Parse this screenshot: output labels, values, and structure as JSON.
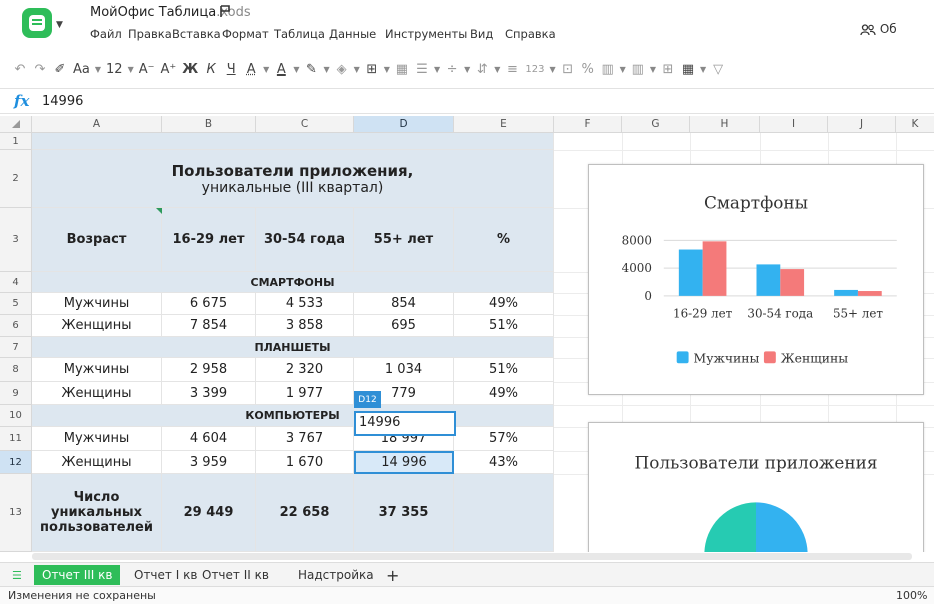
{
  "app": {
    "title": "МойОфис Таблица",
    "ext": ".xods",
    "menu": [
      "Файл",
      "Правка",
      "Вставка",
      "Формат",
      "Таблица",
      "Данные",
      "Инструменты",
      "Вид",
      "Справка"
    ],
    "share": "Об"
  },
  "toolbar": {
    "font_btn": "Aa",
    "font_size": "12",
    "decrease_font": "A⁻",
    "increase_font": "A⁺",
    "bold": "Ж",
    "italic": "К",
    "underline": "Ч",
    "strike": "A",
    "number_format": "123",
    "percent": "%"
  },
  "formula": {
    "icon": "fx",
    "value": "14996"
  },
  "columns": [
    "A",
    "B",
    "C",
    "D",
    "E",
    "F",
    "G",
    "H",
    "I",
    "J",
    "K"
  ],
  "rows": [
    "1",
    "2",
    "3",
    "4",
    "5",
    "6",
    "7",
    "8",
    "9",
    "10",
    "11",
    "12",
    "13"
  ],
  "sheet": {
    "title1": "Пользователи приложения,",
    "title2": "уникальные (III квартал)",
    "head": [
      "Возраст",
      "16-29 лет",
      "30-54 года",
      "55+ лет",
      "%"
    ],
    "sec_phones": "СМАРТФОНЫ",
    "sec_tablets": "ПЛАНШЕТЫ",
    "sec_pc": "КОМПЬЮТЕРЫ",
    "r5": [
      "Мужчины",
      "6 675",
      "4 533",
      "854",
      "49%"
    ],
    "r6": [
      "Женщины",
      "7 854",
      "3 858",
      "695",
      "51%"
    ],
    "r8": [
      "Мужчины",
      "2 958",
      "2 320",
      "1 034",
      "51%"
    ],
    "r9": [
      "Женщины",
      "3 399",
      "1 977",
      "779",
      "49%"
    ],
    "r11": [
      "Мужчины",
      "4 604",
      "3 767",
      "18 997",
      "57%"
    ],
    "r12": [
      "Женщины",
      "3 959",
      "1 670",
      "14 996",
      "43%"
    ],
    "r13_label": "Число уникальных пользователей",
    "r13": [
      "29 449",
      "22 658",
      "37 355"
    ]
  },
  "edit": {
    "ref": "D12",
    "value": "14996"
  },
  "chart_data": [
    {
      "type": "bar",
      "title": "Смартфоны",
      "categories": [
        "16-29 лет",
        "30-54 года",
        "55+ лет"
      ],
      "series": [
        {
          "name": "Мужчины",
          "values": [
            6675,
            4533,
            854
          ],
          "color": "#33b2f0"
        },
        {
          "name": "Женщины",
          "values": [
            7854,
            3858,
            695
          ],
          "color": "#f47a7a"
        }
      ],
      "yticks": [
        "8000",
        "4000",
        "0"
      ],
      "ylim": [
        0,
        8000
      ],
      "legend": "bottom"
    },
    {
      "type": "pie",
      "title": "Пользователи приложения",
      "colors": [
        "#26cbb2",
        "#33b2f0"
      ]
    }
  ],
  "tabs": [
    "Отчет III кв",
    "Отчет I кв",
    "Отчет II кв",
    "Надстройка"
  ],
  "add_sheet": "+",
  "status": {
    "message": "Изменения не сохранены",
    "zoom": "100%"
  }
}
